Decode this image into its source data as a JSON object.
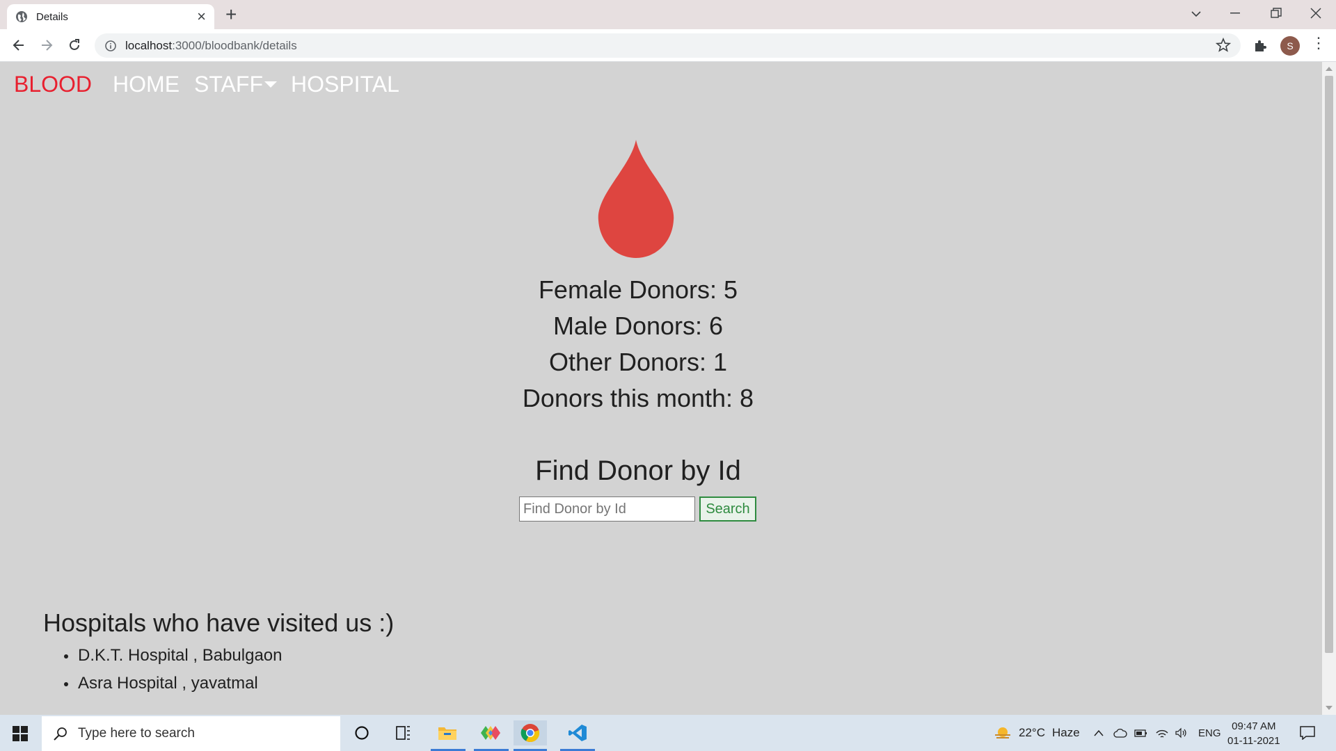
{
  "browser": {
    "tab_title": "Details",
    "url_host": "localhost",
    "url_path": ":3000/bloodbank/details",
    "avatar_letter": "S"
  },
  "nav": {
    "brand": "BLOOD",
    "links": [
      "HOME",
      "STAFF",
      "HOSPITAL"
    ]
  },
  "stats": {
    "female": "Female Donors: 5",
    "male": "Male Donors: 6",
    "other": "Other Donors: 1",
    "month": "Donors this month: 8"
  },
  "find": {
    "title": "Find Donor by Id",
    "placeholder": "Find Donor by Id",
    "button": "Search"
  },
  "hospitals": {
    "heading": "Hospitals who have visited us :)",
    "items": [
      "D.K.T. Hospital , Babulgaon",
      "Asra Hospital , yavatmal"
    ]
  },
  "taskbar": {
    "search_placeholder": "Type here to search",
    "weather_temp": "22°C",
    "weather_desc": "Haze",
    "language": "ENG",
    "time": "09:47 AM",
    "date": "01-11-2021"
  },
  "colors": {
    "brand": "#e8202f",
    "drop": "#de4540",
    "page_bg": "#d3d3d3",
    "search_button": "#2e8b3f"
  }
}
